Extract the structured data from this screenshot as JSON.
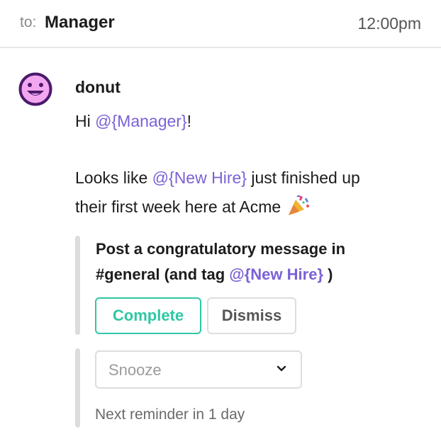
{
  "header": {
    "to_label": "to:",
    "recipient": "Manager",
    "time": "12:00pm"
  },
  "message": {
    "sender": "donut",
    "greeting_prefix": "Hi ",
    "greeting_mention": "@{Manager}",
    "greeting_suffix": "!",
    "body_line1_prefix": "Looks like ",
    "body_line1_mention": "@{New Hire}",
    "body_line1_suffix": " just finished up",
    "body_line2": "their first week here at Acme",
    "emoji": "party-popper-icon"
  },
  "task": {
    "title_line1": "Post a congratulatory message in",
    "title_line2_prefix": "#general (and tag ",
    "title_line2_mention": "@{New Hire}",
    "title_line2_suffix": " )",
    "complete_label": "Complete",
    "dismiss_label": "Dismiss"
  },
  "snooze": {
    "selected": "Snooze",
    "reminder": "Next reminder in 1 day"
  },
  "colors": {
    "mention": "#7b61d6",
    "complete": "#2fc7a5",
    "avatar_fill": "#f3a6f0",
    "avatar_outline": "#4a1a6b"
  }
}
